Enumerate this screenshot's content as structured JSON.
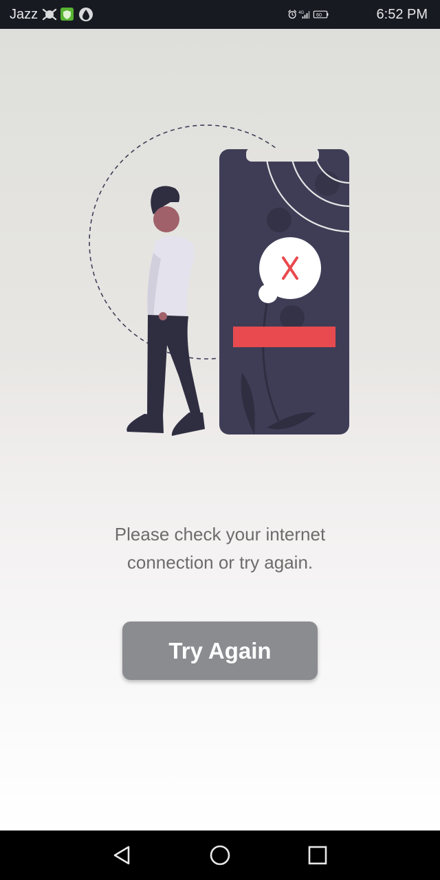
{
  "status_bar": {
    "carrier": "Jazz",
    "network": "4G",
    "battery_level": "60",
    "time": "6:52 PM",
    "left_icons": [
      "signal-booster-icon",
      "shield-app-icon",
      "drop-app-icon"
    ],
    "right_icons": [
      "alarm-icon",
      "signal-bars-icon",
      "battery-icon"
    ]
  },
  "illustration": {
    "icon": "no-connection-illustration",
    "accent_color": "#e84a4f",
    "phone_color": "#3f3d56",
    "error_mark": "X"
  },
  "message": {
    "line1": "Please check your internet",
    "line2": "connection or try again."
  },
  "button": {
    "label": "Try Again",
    "color": "#8a8c90"
  },
  "nav_bar": {
    "icons": [
      "back-icon",
      "home-icon",
      "recents-icon"
    ]
  }
}
